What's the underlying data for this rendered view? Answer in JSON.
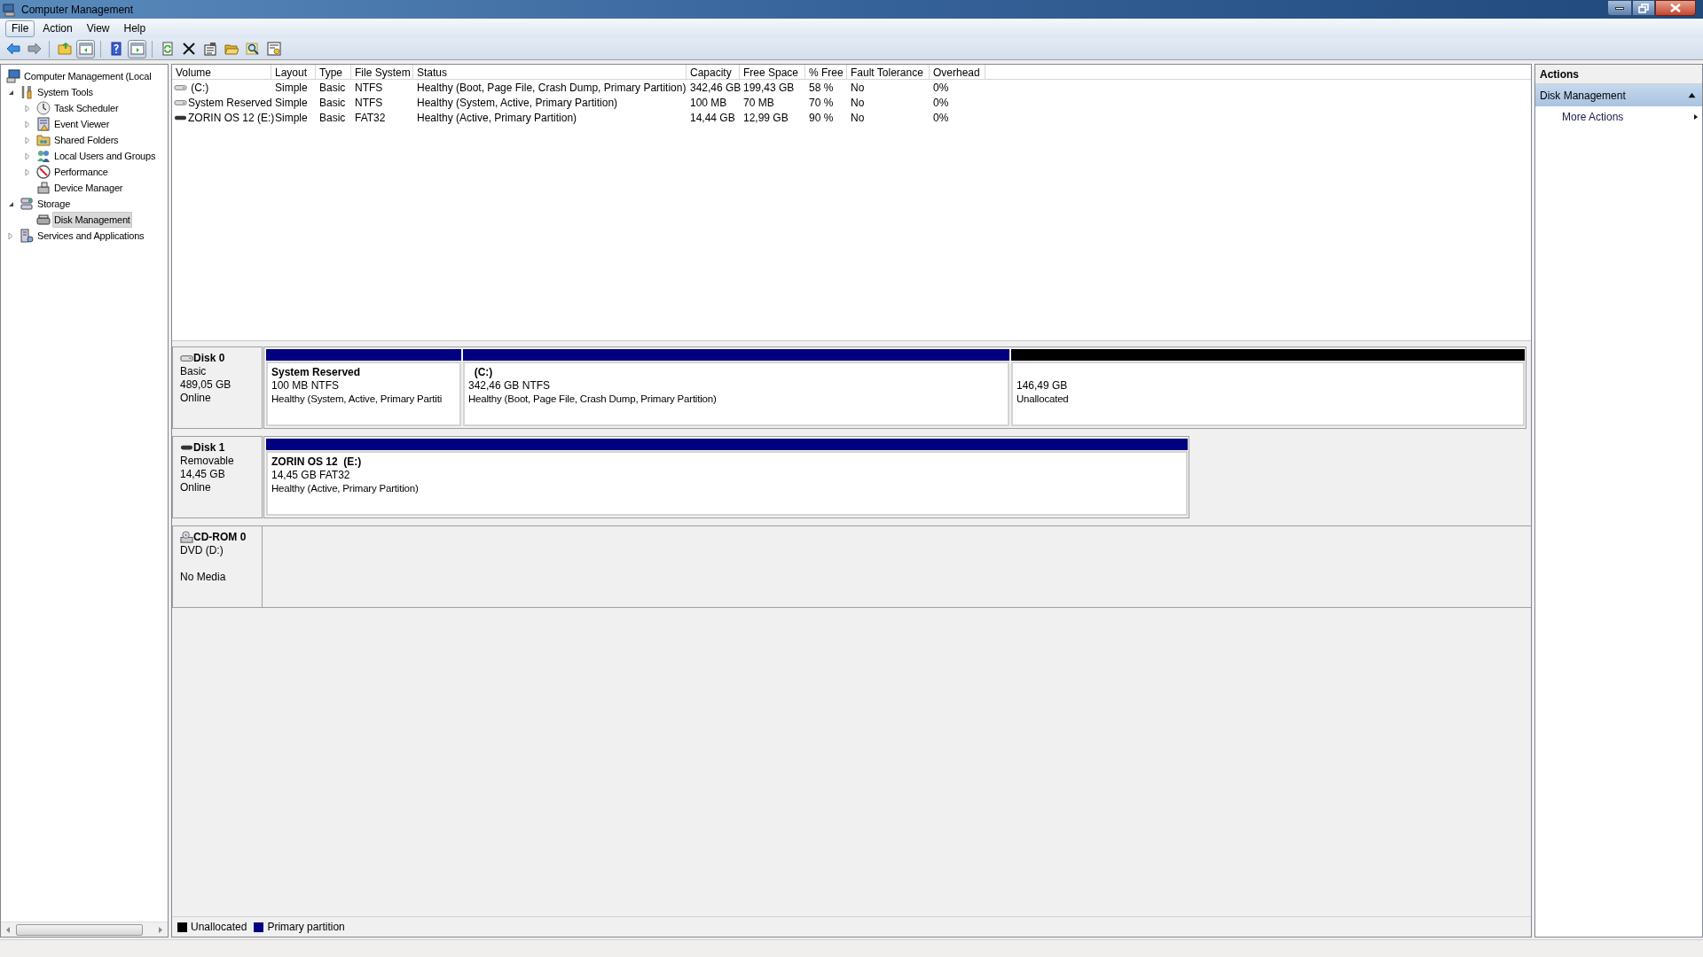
{
  "window": {
    "title": "Computer Management"
  },
  "menu": [
    {
      "label": "File",
      "selected": true
    },
    {
      "label": "Action",
      "selected": false
    },
    {
      "label": "View",
      "selected": false
    },
    {
      "label": "Help",
      "selected": false
    }
  ],
  "toolbar": [
    {
      "pressed": false
    },
    {
      "pressed": false
    },
    {
      "pressed": false
    },
    {
      "pressed": true
    },
    {
      "pressed": false
    },
    {
      "pressed": true
    },
    {
      "pressed": false
    },
    {
      "pressed": false
    },
    {
      "pressed": false
    },
    {
      "pressed": false
    },
    {
      "pressed": false
    },
    {
      "pressed": false
    }
  ],
  "tree": [
    {
      "label": "Computer Management (Local",
      "selected": false,
      "children": [
        {
          "label": "System Tools",
          "expanded": true,
          "selected": false,
          "children": [
            {
              "label": "Task Scheduler",
              "expanded": false,
              "selected": false
            },
            {
              "label": "Event Viewer",
              "expanded": false,
              "selected": false
            },
            {
              "label": "Shared Folders",
              "expanded": false,
              "selected": false
            },
            {
              "label": "Local Users and Groups",
              "expanded": false,
              "selected": false
            },
            {
              "label": "Performance",
              "expanded": false,
              "selected": false
            },
            {
              "label": "Device Manager",
              "selected": false
            }
          ]
        },
        {
          "label": "Storage",
          "expanded": true,
          "selected": false,
          "children": [
            {
              "label": "Disk Management",
              "selected": true
            }
          ]
        },
        {
          "label": "Services and Applications",
          "expanded": false,
          "selected": false
        }
      ]
    }
  ],
  "volumes": {
    "columns": [
      "Volume",
      "Layout",
      "Type",
      "File System",
      "Status",
      "Capacity",
      "Free Space",
      "% Free",
      "Fault Tolerance",
      "Overhead"
    ],
    "rows": [
      {
        "kind": "fixed",
        "cells": [
          " (C:)",
          "Simple",
          "Basic",
          "NTFS",
          "Healthy (Boot, Page File, Crash Dump, Primary Partition)",
          "342,46 GB",
          "199,43 GB",
          "58 %",
          "No",
          "0%"
        ]
      },
      {
        "kind": "fixed",
        "cells": [
          "System Reserved",
          "Simple",
          "Basic",
          "NTFS",
          "Healthy (System, Active, Primary Partition)",
          "100 MB",
          "70 MB",
          "70 %",
          "No",
          "0%"
        ]
      },
      {
        "kind": "removable",
        "cells": [
          "ZORIN OS 12 (E:)",
          "Simple",
          "Basic",
          "FAT32",
          "Healthy (Active, Primary Partition)",
          "14,44 GB",
          "12,99 GB",
          "90 %",
          "No",
          "0%"
        ]
      }
    ]
  },
  "disks": [
    {
      "kind": "fixed",
      "name": "Disk 0",
      "lines": [
        "Basic",
        "489,05 GB",
        "Online"
      ],
      "partitions": [
        {
          "kind": "primary",
          "name": "System Reserved",
          "size": "100 MB NTFS",
          "status": "Healthy (System, Active, Primary Partiti"
        },
        {
          "kind": "primary",
          "name": "  (C:)",
          "size": "342,46 GB NTFS",
          "status": "Healthy (Boot, Page File, Crash Dump, Primary Partition)"
        },
        {
          "kind": "unallocated",
          "size": "146,49 GB",
          "status": "Unallocated"
        }
      ]
    },
    {
      "kind": "removable",
      "name": "Disk 1",
      "lines": [
        "Removable",
        "14,45 GB",
        "Online"
      ],
      "partitions": [
        {
          "kind": "primary",
          "name": "ZORIN OS 12  (E:)",
          "size": "14,45 GB FAT32",
          "status": "Healthy (Active, Primary Partition)"
        }
      ]
    },
    {
      "kind": "cdrom",
      "name": "CD-ROM 0",
      "lines": [
        "DVD (D:)",
        "No Media"
      ]
    }
  ],
  "legend": [
    {
      "label": "Unallocated",
      "color": "#000000"
    },
    {
      "label": "Primary partition",
      "color": "#000080"
    }
  ],
  "actions": {
    "title": "Actions",
    "section": {
      "label": "Disk Management",
      "expanded": true
    },
    "items": [
      "More Actions"
    ]
  }
}
